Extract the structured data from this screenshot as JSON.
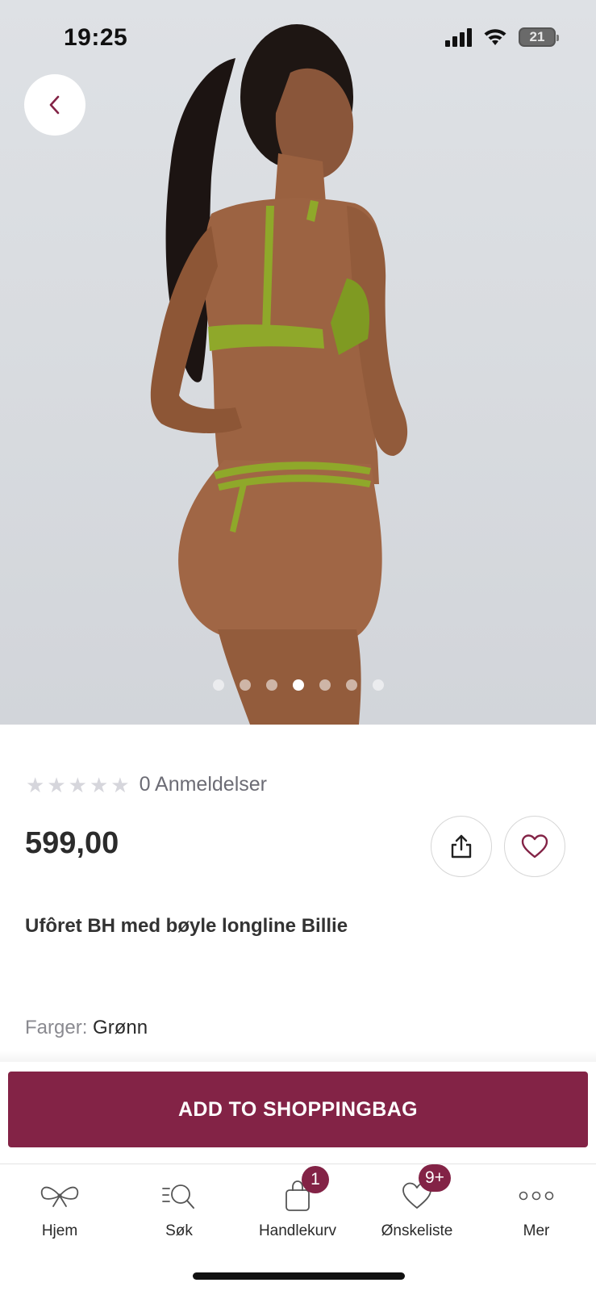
{
  "status_bar": {
    "time": "19:25",
    "battery": "21"
  },
  "gallery": {
    "image_count": 7,
    "active_index": 3
  },
  "product": {
    "rating_stars": 0,
    "reviews_label": "0 Anmeldelser",
    "price": "599,00",
    "title": "Ufôret BH med bøyle longline Billie",
    "colors_label": "Farger:",
    "colors_value": "Grønn"
  },
  "actions": {
    "add_to_bag_label": "ADD TO SHOPPINGBAG"
  },
  "tabbar": {
    "home": "Hjem",
    "search": "Søk",
    "cart": "Handlekurv",
    "cart_badge": "1",
    "wishlist": "Ønskeliste",
    "wishlist_badge": "9+",
    "more": "Mer"
  },
  "colors": {
    "accent": "#832346",
    "lingerie": "#8fa82a",
    "background": "#dcdfe3"
  }
}
